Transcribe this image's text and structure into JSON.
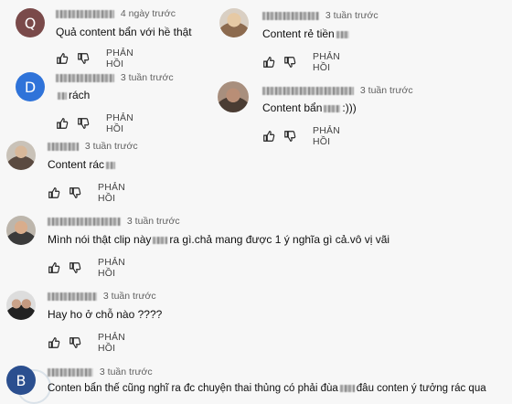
{
  "comments": [
    {
      "avatar_letter": "Q",
      "avatar_color": "#7a4a4a",
      "time": "4 ngày trước",
      "text": "Quả content bẩn với hề thật",
      "reply": "PHẢN HỒI"
    },
    {
      "time": "3 tuần trước",
      "text": "Content rẻ tiền",
      "reply": "PHẢN HỒI"
    },
    {
      "avatar_letter": "D",
      "avatar_color": "#2f73d9",
      "time": "3 tuần trước",
      "text": "rách",
      "reply": "PHẢN HỒI"
    },
    {
      "time": "3 tuần trước",
      "text_a": "Content bẩn",
      "text_b": ":)))",
      "reply": "PHẢN HỒI"
    },
    {
      "time": "3 tuần trước",
      "text": "Content rác",
      "reply": "PHẢN HỒI"
    },
    {
      "time": "3 tuần trước",
      "text_a": "Mình nói thật clip này",
      "text_b": "ra gì.chả mang được 1 ý nghĩa gì cả.vô vị vãi",
      "reply": "PHẢN HỒI"
    },
    {
      "time": "3 tuần trước",
      "text": "Hay ho ở chỗ nào ????",
      "reply": "PHẢN HỒI"
    },
    {
      "avatar_letter": "B",
      "avatar_color": "#2b4f8f",
      "time": "3 tuần trước",
      "text_a": "Conten bẩn thế cũng nghĩ ra đc chuyện thai thủng có phải đùa",
      "text_b": "đâu conten ý tưởng rác qua",
      "reply": "PHẢN HỒI"
    }
  ],
  "icons": {
    "like": "thumbs-up-icon",
    "dislike": "thumbs-down-icon"
  }
}
